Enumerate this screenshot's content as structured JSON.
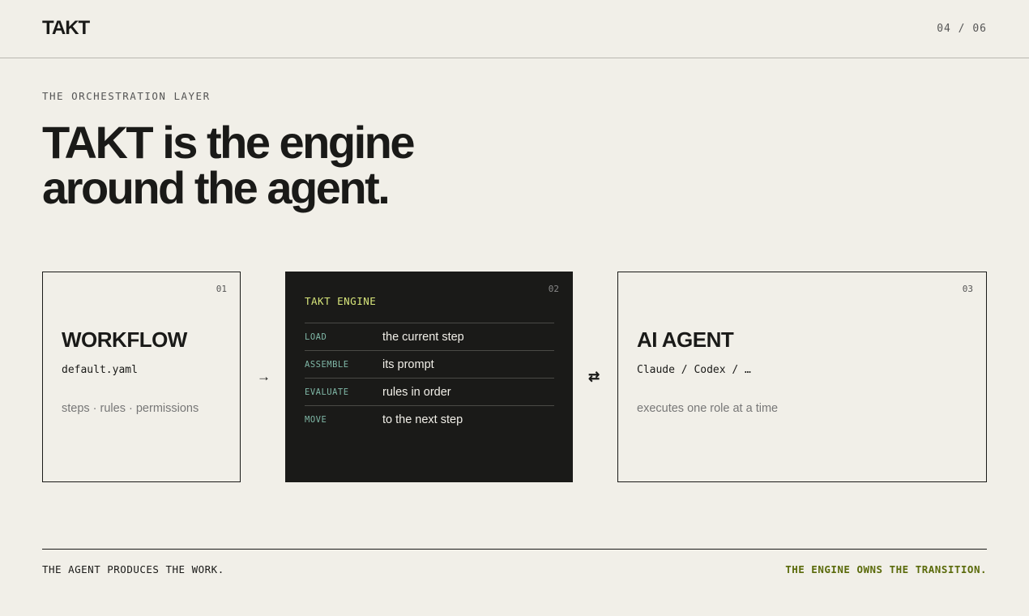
{
  "header": {
    "logo": "TAKT",
    "pager": "04 / 06"
  },
  "hero": {
    "eyebrow": "THE ORCHESTRATION LAYER",
    "line1": "TAKT is the engine",
    "line2": "around the agent."
  },
  "cards": {
    "workflow": {
      "num": "01",
      "title": "WORKFLOW",
      "file": "default.yaml",
      "desc": "steps · rules · permissions"
    },
    "engine": {
      "num": "02",
      "title": "TAKT ENGINE",
      "rows": [
        {
          "key": "LOAD",
          "value": "the current step"
        },
        {
          "key": "ASSEMBLE",
          "value": "its prompt"
        },
        {
          "key": "EVALUATE",
          "value": "rules in order"
        },
        {
          "key": "MOVE",
          "value": "to the next step"
        }
      ]
    },
    "agent": {
      "num": "03",
      "title": "AI AGENT",
      "file": "Claude / Codex / …",
      "desc": "executes one role at a time"
    }
  },
  "arrows": {
    "right": "→",
    "swap": "⇄"
  },
  "footer": {
    "left": "THE AGENT PRODUCES THE WORK.",
    "right": "THE ENGINE OWNS THE TRANSITION."
  },
  "colors": {
    "background": "#f1efe8",
    "ink": "#1a1a18",
    "engine_title": "#d7e57a",
    "engine_keys": "#7fb7a6",
    "footer_accent": "#5a6a0a"
  }
}
